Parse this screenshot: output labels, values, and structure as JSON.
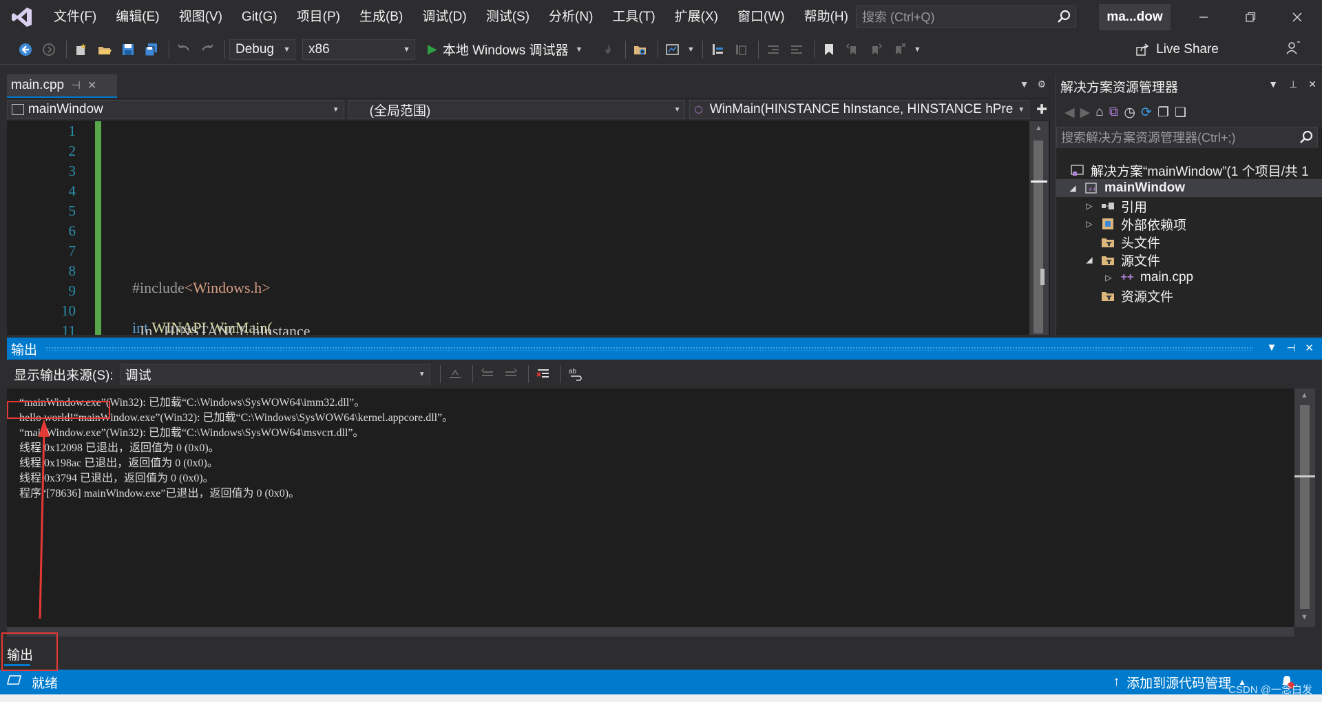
{
  "menubar": {
    "items": [
      "文件(F)",
      "编辑(E)",
      "视图(V)",
      "Git(G)",
      "项目(P)",
      "生成(B)",
      "调试(D)",
      "测试(S)",
      "分析(N)",
      "工具(T)",
      "扩展(X)",
      "窗口(W)",
      "帮助(H)"
    ],
    "search_placeholder": "搜索 (Ctrl+Q)",
    "window_title": "ma...dow"
  },
  "toolbar": {
    "config": "Debug",
    "platform": "x86",
    "run_label": "本地 Windows 调试器",
    "live_share": "Live Share"
  },
  "editor": {
    "tab_name": "main.cpp",
    "nav_project": "mainWindow",
    "nav_scope": "(全局范围)",
    "nav_member": "WinMain(HINSTANCE hInstance, HINSTANCE hPrev",
    "line_numbers": [
      "1",
      "2",
      "3",
      "4",
      "5",
      "6",
      "7",
      "8",
      "9",
      "10",
      "11"
    ],
    "include_kw": "#include",
    "include_file": "<Windows.h>",
    "line10_type": "int",
    "line10_rest": "WINAPI WinMain(",
    "line11_text": "    _In_ HINSTANCE hInstance"
  },
  "solution_explorer": {
    "title": "解决方案资源管理器",
    "search_placeholder": "搜索解决方案资源管理器(Ctrl+;)",
    "tree": {
      "solution": "解决方案“mainWindow”(1 个项目/共 1",
      "project": "mainWindow",
      "references": "引用",
      "external_deps": "外部依赖项",
      "header_files": "头文件",
      "source_files": "源文件",
      "main_cpp": "main.cpp",
      "resource_files": "资源文件"
    }
  },
  "output": {
    "title": "输出",
    "source_label": "显示输出来源(S):",
    "source_value": "调试",
    "lines": [
      "“mainWindow.exe”(Win32): 已加载“C:\\Windows\\SysWOW64\\imm32.dll”。",
      "hello world!“mainWindow.exe”(Win32): 已加载“C:\\Windows\\SysWOW64\\kernel.appcore.dll”。",
      "“mainWindow.exe”(Win32): 已加载“C:\\Windows\\SysWOW64\\msvcrt.dll”。",
      "线程 0x12098 已退出，返回值为 0 (0x0)。",
      "线程 0x198ac 已退出，返回值为 0 (0x0)。",
      "线程 0x3794 已退出，返回值为 0 (0x0)。",
      "程序“[78636] mainWindow.exe”已退出，返回值为 0 (0x0)。"
    ],
    "bottom_tab": "输出"
  },
  "status": {
    "ready": "就绪",
    "add_to_source_control": "添加到源代码管理",
    "watermark": "CSDN @一念白发"
  },
  "colors": {
    "accent": "#007acc",
    "annotation": "#e53935",
    "code_keyword": "#569cd6",
    "code_include": "#9b9b9b",
    "code_string": "#d69d85",
    "line_number": "#2b91af"
  }
}
